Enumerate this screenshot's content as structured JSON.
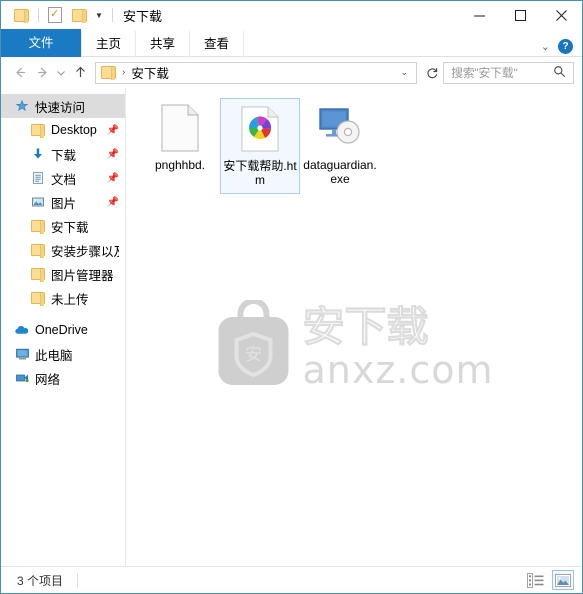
{
  "window": {
    "title": "安下载",
    "quick_access_toolbar": {
      "folder_icon": "folder-icon",
      "properties_icon": "properties-icon",
      "new_folder_icon": "new-folder-icon",
      "customize_caret": "chevron-down-icon"
    },
    "controls": {
      "minimize": "minimize-icon",
      "maximize": "maximize-icon",
      "close": "close-icon"
    }
  },
  "ribbon": {
    "tabs": [
      {
        "label": "文件",
        "active": true
      },
      {
        "label": "主页",
        "active": false
      },
      {
        "label": "共享",
        "active": false
      },
      {
        "label": "查看",
        "active": false
      }
    ],
    "collapse_icon": "chevron-down-icon",
    "help_label": "?"
  },
  "address_bar": {
    "back_icon": "arrow-left-icon",
    "forward_icon": "arrow-right-icon",
    "recent_icon": "chevron-down-icon",
    "up_icon": "arrow-up-icon",
    "breadcrumb_folder_icon": "folder-icon",
    "breadcrumb_separator": "›",
    "path": "安下载",
    "dropdown_icon": "chevron-down-icon",
    "refresh_icon": "refresh-icon",
    "search": {
      "placeholder": "搜索\"安下载\"",
      "icon": "search-icon"
    }
  },
  "sidebar": {
    "items": [
      {
        "label": "快速访问",
        "icon": "star-pin-icon",
        "level": 0,
        "selected": true,
        "pinned": false
      },
      {
        "label": "Desktop",
        "icon": "folder-icon",
        "level": 1,
        "selected": false,
        "pinned": true
      },
      {
        "label": "下载",
        "icon": "download-icon",
        "level": 1,
        "selected": false,
        "pinned": true
      },
      {
        "label": "文档",
        "icon": "documents-icon",
        "level": 1,
        "selected": false,
        "pinned": true
      },
      {
        "label": "图片",
        "icon": "pictures-icon",
        "level": 1,
        "selected": false,
        "pinned": true
      },
      {
        "label": "安下载",
        "icon": "folder-icon",
        "level": 1,
        "selected": false,
        "pinned": false
      },
      {
        "label": "安装步骤以及",
        "icon": "folder-icon",
        "level": 1,
        "selected": false,
        "pinned": false
      },
      {
        "label": "图片管理器",
        "icon": "folder-icon",
        "level": 1,
        "selected": false,
        "pinned": false
      },
      {
        "label": "未上传",
        "icon": "folder-icon",
        "level": 1,
        "selected": false,
        "pinned": false
      },
      {
        "label": "OneDrive",
        "icon": "onedrive-icon",
        "level": 0,
        "selected": false,
        "pinned": false
      },
      {
        "label": "此电脑",
        "icon": "this-pc-icon",
        "level": 0,
        "selected": false,
        "pinned": false
      },
      {
        "label": "网络",
        "icon": "network-icon",
        "level": 0,
        "selected": false,
        "pinned": false
      }
    ]
  },
  "files": [
    {
      "name": "pnghhbd.",
      "icon": "blank-document-icon",
      "selected": false
    },
    {
      "name": "安下载帮助.htm",
      "icon": "pinwheel-html-document-icon",
      "selected": true
    },
    {
      "name": "dataguardian.exe",
      "icon": "monitor-disc-application-icon",
      "selected": false
    }
  ],
  "watermark": {
    "logo_icon": "anxz-bag-shield-logo",
    "brand_cn": "安下载",
    "domain": "anxz.com"
  },
  "status_bar": {
    "item_count_text": "3 个项目",
    "views": [
      {
        "icon": "details-view-icon",
        "active": false
      },
      {
        "icon": "large-icons-view-icon",
        "active": true
      }
    ]
  },
  "colors": {
    "accent_blue": "#1a7bc4",
    "window_border": "#4a8fb5",
    "selection_fill": "#f2f8fd",
    "selection_border": "#a8cfe8",
    "nav_selected": "#dcdcdc",
    "folder_yellow": "#fcdd93",
    "watermark_gray": "#d8d8d8"
  }
}
